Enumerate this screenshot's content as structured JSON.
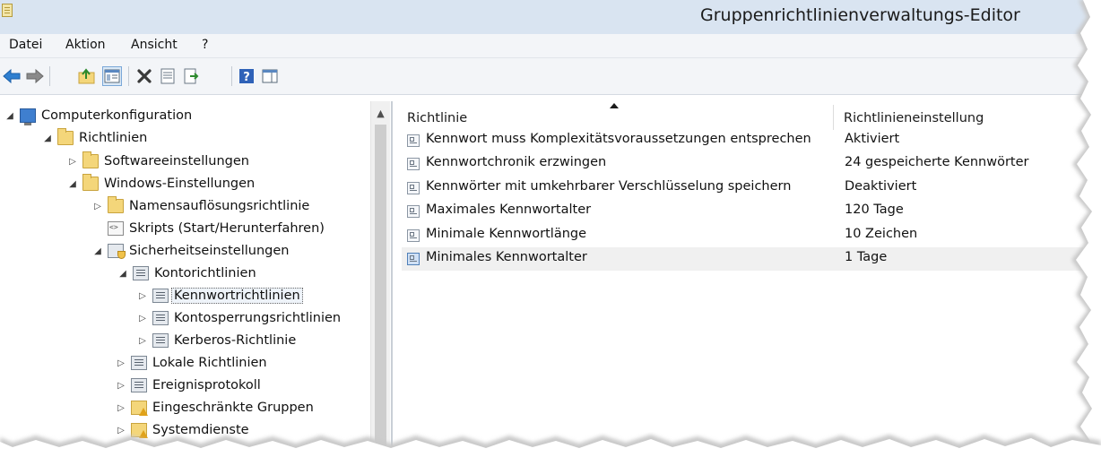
{
  "window": {
    "title": "Gruppenrichtlinienverwaltungs-Editor"
  },
  "menu": {
    "items": [
      "Datei",
      "Aktion",
      "Ansicht",
      "?"
    ]
  },
  "toolbar": {
    "buttons": [
      "back-icon",
      "forward-icon",
      "up-folder-icon",
      "show-hide-tree-icon",
      "delete-icon",
      "properties-icon",
      "export-list-icon",
      "help-icon",
      "show-hide-action-pane-icon"
    ]
  },
  "tree": {
    "items": [
      {
        "label": "Computerkonfiguration",
        "icon": "computer-icon",
        "expander": "expanded"
      },
      {
        "label": "Richtlinien",
        "icon": "folder-icon",
        "expander": "expanded"
      },
      {
        "label": "Softwareeinstellungen",
        "icon": "folder-icon",
        "expander": "collapsed"
      },
      {
        "label": "Windows-Einstellungen",
        "icon": "folder-icon",
        "expander": "expanded"
      },
      {
        "label": "Namensauflösungsrichtlinie",
        "icon": "folder-icon",
        "expander": "collapsed"
      },
      {
        "label": "Skripts (Start/Herunterfahren)",
        "icon": "script-icon",
        "expander": "none"
      },
      {
        "label": "Sicherheitseinstellungen",
        "icon": "security-settings-icon",
        "expander": "expanded"
      },
      {
        "label": "Kontorichtlinien",
        "icon": "policy-icon",
        "expander": "expanded"
      },
      {
        "label": "Kennwortrichtlinien",
        "icon": "policy-icon",
        "expander": "collapsed",
        "selected": true
      },
      {
        "label": "Kontosperrungsrichtlinien",
        "icon": "policy-icon",
        "expander": "collapsed"
      },
      {
        "label": "Kerberos-Richtlinie",
        "icon": "policy-icon",
        "expander": "collapsed"
      },
      {
        "label": "Lokale Richtlinien",
        "icon": "policy-icon",
        "expander": "collapsed"
      },
      {
        "label": "Ereignisprotokoll",
        "icon": "policy-icon",
        "expander": "collapsed"
      },
      {
        "label": "Eingeschränkte Gruppen",
        "icon": "restricted-folder-icon",
        "expander": "collapsed"
      },
      {
        "label": "Systemdienste",
        "icon": "restricted-folder-icon",
        "expander": "collapsed"
      }
    ]
  },
  "grid": {
    "columns": [
      "Richtlinie",
      "Richtlinieneinstellung"
    ],
    "rows": [
      {
        "policy": "Kennwort muss Komplexitätsvoraussetzungen entsprechen",
        "setting": "Aktiviert"
      },
      {
        "policy": "Kennwortchronik erzwingen",
        "setting": "24 gespeicherte Kennwörter"
      },
      {
        "policy": "Kennwörter mit umkehrbarer Verschlüsselung speichern",
        "setting": "Deaktiviert"
      },
      {
        "policy": "Maximales Kennwortalter",
        "setting": "120 Tage"
      },
      {
        "policy": "Minimale Kennwortlänge",
        "setting": "10 Zeichen"
      },
      {
        "policy": "Minimales Kennwortalter",
        "setting": "1 Tage",
        "selected": true
      }
    ]
  },
  "colors": {
    "titlebar": "#d9e4f1",
    "toolbar": "#f3f5f8",
    "selection": "#f0f0f0"
  }
}
